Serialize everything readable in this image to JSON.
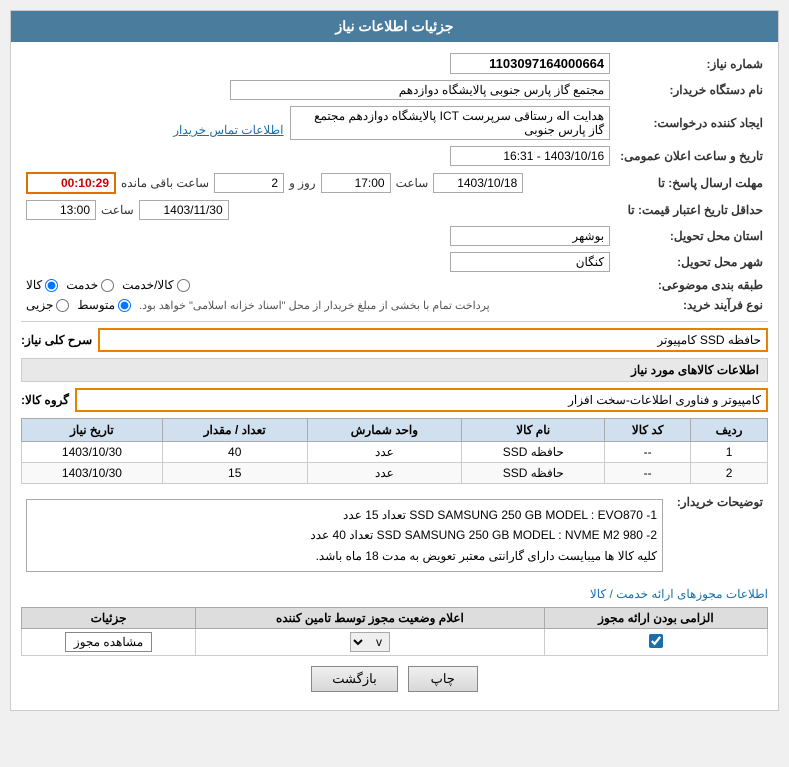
{
  "header": {
    "title": "جزئیات اطلاعات نیاز"
  },
  "fields": {
    "shomara_niaz_label": "شماره نیاز:",
    "shomara_niaz_value": "1103097164000664",
    "name_destgah_label": "نام دستگاه خریدار:",
    "name_destgah_value": "مجتمع گاز پارس جنوبی  پالایشگاه دوازدهم",
    "creator_label": "ایجاد کننده درخواست:",
    "creator_value": "هدایت اله رستاقی سرپرست ICT پالایشگاه دوازدهم  مجتمع گاز پارس جنوبی",
    "contact_link": "اطلاعات تماس خریدار",
    "tarikh_label": "تاریخ و ساعت اعلان عمومی:",
    "tarikh_value": "1403/10/16 - 16:31",
    "mohlat_ersal_label": "مهلت ارسال پاسخ: تا",
    "mohlat_date": "1403/10/18",
    "mohlat_saat_label": "ساعت",
    "mohlat_saat": "17:00",
    "mohlat_rooz_label": "روز و",
    "mohlat_rooz": "2",
    "mohlat_mande_label": "ساعت باقی مانده",
    "mohlat_mande": "00:10:29",
    "hadaqal_label": "حداقل تاریخ اعتبار قیمت: تا",
    "hadaqal_date": "1403/11/30",
    "hadaqal_saat_label": "ساعت",
    "hadaqal_saat": "13:00",
    "ostan_label": "استان محل تحویل:",
    "ostan_value": "بوشهر",
    "shahr_label": "شهر محل تحویل:",
    "shahr_value": "کنگان",
    "tabaqe_label": "طبقه بندی موضوعی:",
    "tabaqe_options": [
      "کالا",
      "خدمت",
      "کالا/خدمت"
    ],
    "tabaqe_selected": "کالا",
    "nooe_farayand_label": "نوع فرآیند خرید:",
    "nooe_options": [
      "جزیی",
      "متوسط"
    ],
    "nooe_note": "پرداخت تمام با بخشی از مبلغ خریدار از محل \"اسناد خزانه اسلامی\" خواهد بود.",
    "sarh_koli_label": "سرح کلی نیاز:",
    "sarh_koli_value": "حافظه SSD کامپیوتر",
    "group_kala_label": "گروه کالا:",
    "group_kala_value": "کامپیوتر و فناوری اطلاعات-سخت افزار",
    "table_headers": [
      "ردیف",
      "کد کالا",
      "نام کالا",
      "واحد شمارش",
      "تعداد / مقدار",
      "تاریخ نیاز"
    ],
    "table_rows": [
      {
        "radif": "1",
        "kod": "--",
        "name": "حافظه SSD",
        "vahed": "عدد",
        "tedad": "40",
        "tarikh": "1403/10/30"
      },
      {
        "radif": "2",
        "kod": "--",
        "name": "حافظه SSD",
        "vahed": "عدد",
        "tedad": "15",
        "tarikh": "1403/10/30"
      }
    ],
    "notes_label": "توضیحات خریدار:",
    "notes_lines": [
      "1- SSD SAMSUNG 250 GB MODEL : EVO870  تعداد 15 عدد",
      "2- SSD SAMSUNG 250 GB MODEL : NVME M2 980  تعداد 40 عدد",
      "کلیه کالا ها میبایست دارای گارانتی معتبر تعویض به مدت 18 ماه باشد."
    ],
    "mojoz_link": "اطلاعات مجوزهای ارائه خدمت / کالا",
    "sub_table_headers": [
      "الزامی بودن ارائه مجوز",
      "اعلام وضعیت مجوز توسط تامین کننده",
      "جزئیات"
    ],
    "sub_row": {
      "elzami": true,
      "ealam": "v",
      "jaziat_btn": "مشاهده مجوز"
    },
    "btn_chap": "چاپ",
    "btn_bazgasht": "بازگشت"
  }
}
